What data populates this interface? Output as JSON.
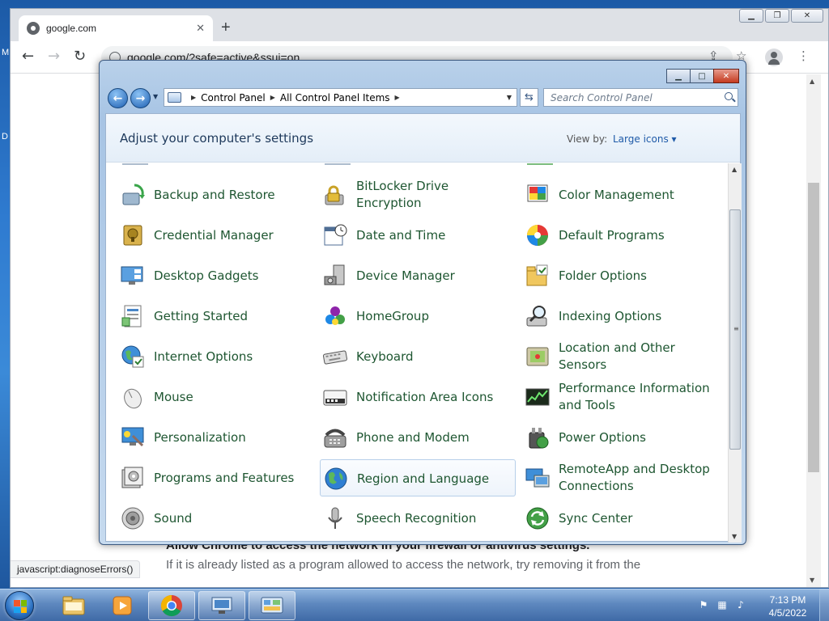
{
  "desktop": {
    "edge_glyph_top": "M",
    "edge_glyph_mid": "D"
  },
  "browser": {
    "tab_title": "google.com",
    "tab_close": "✕",
    "new_tab": "+",
    "address": "google.com/?safe=active&ssui=on",
    "page_heading": "Allow Chrome to access the network in your firewall or antivirus settings.",
    "page_body": "If it is already listed as a program allowed to access the network, try removing it from the",
    "status_tip": "javascript:diagnoseErrors()"
  },
  "control_panel": {
    "breadcrumb": [
      "Control Panel",
      "All Control Panel Items"
    ],
    "search_placeholder": "Search Control Panel",
    "heading": "Adjust your computer's settings",
    "view_by_label": "View by:",
    "view_by_value": "Large icons ▾",
    "items": [
      {
        "label": "Backup and Restore",
        "icon": "backup-icon"
      },
      {
        "label": "BitLocker Drive Encryption",
        "icon": "bitlocker-icon"
      },
      {
        "label": "Color Management",
        "icon": "color-management-icon"
      },
      {
        "label": "Credential Manager",
        "icon": "credential-icon"
      },
      {
        "label": "Date and Time",
        "icon": "calendar-icon"
      },
      {
        "label": "Default Programs",
        "icon": "default-programs-icon"
      },
      {
        "label": "Desktop Gadgets",
        "icon": "gadgets-icon"
      },
      {
        "label": "Device Manager",
        "icon": "device-manager-icon"
      },
      {
        "label": "Folder Options",
        "icon": "folder-icon"
      },
      {
        "label": "Getting Started",
        "icon": "getting-started-icon"
      },
      {
        "label": "HomeGroup",
        "icon": "homegroup-icon"
      },
      {
        "label": "Indexing Options",
        "icon": "indexing-icon"
      },
      {
        "label": "Internet Options",
        "icon": "internet-icon"
      },
      {
        "label": "Keyboard",
        "icon": "keyboard-icon"
      },
      {
        "label": "Location and Other Sensors",
        "icon": "location-icon"
      },
      {
        "label": "Mouse",
        "icon": "mouse-icon"
      },
      {
        "label": "Notification Area Icons",
        "icon": "notification-icon"
      },
      {
        "label": "Performance Information and Tools",
        "icon": "performance-icon"
      },
      {
        "label": "Personalization",
        "icon": "personalization-icon"
      },
      {
        "label": "Phone and Modem",
        "icon": "phone-icon"
      },
      {
        "label": "Power Options",
        "icon": "power-icon"
      },
      {
        "label": "Programs and Features",
        "icon": "programs-icon"
      },
      {
        "label": "Region and Language",
        "icon": "globe-icon"
      },
      {
        "label": "RemoteApp and Desktop Connections",
        "icon": "remoteapp-icon"
      },
      {
        "label": "Sound",
        "icon": "sound-icon"
      },
      {
        "label": "Speech Recognition",
        "icon": "microphone-icon"
      },
      {
        "label": "Sync Center",
        "icon": "sync-icon"
      }
    ],
    "hovered_item": "Region and Language"
  },
  "taskbar": {
    "clock_time": "7:13 PM",
    "clock_date": "4/5/2022",
    "pinned": [
      "file-explorer-icon",
      "media-player-icon",
      "chrome-icon",
      "network-icon",
      "control-panel-icon"
    ]
  },
  "colors": {
    "item_label": "#1e5631",
    "link": "#1e5aa8",
    "heading": "#1e395b"
  }
}
